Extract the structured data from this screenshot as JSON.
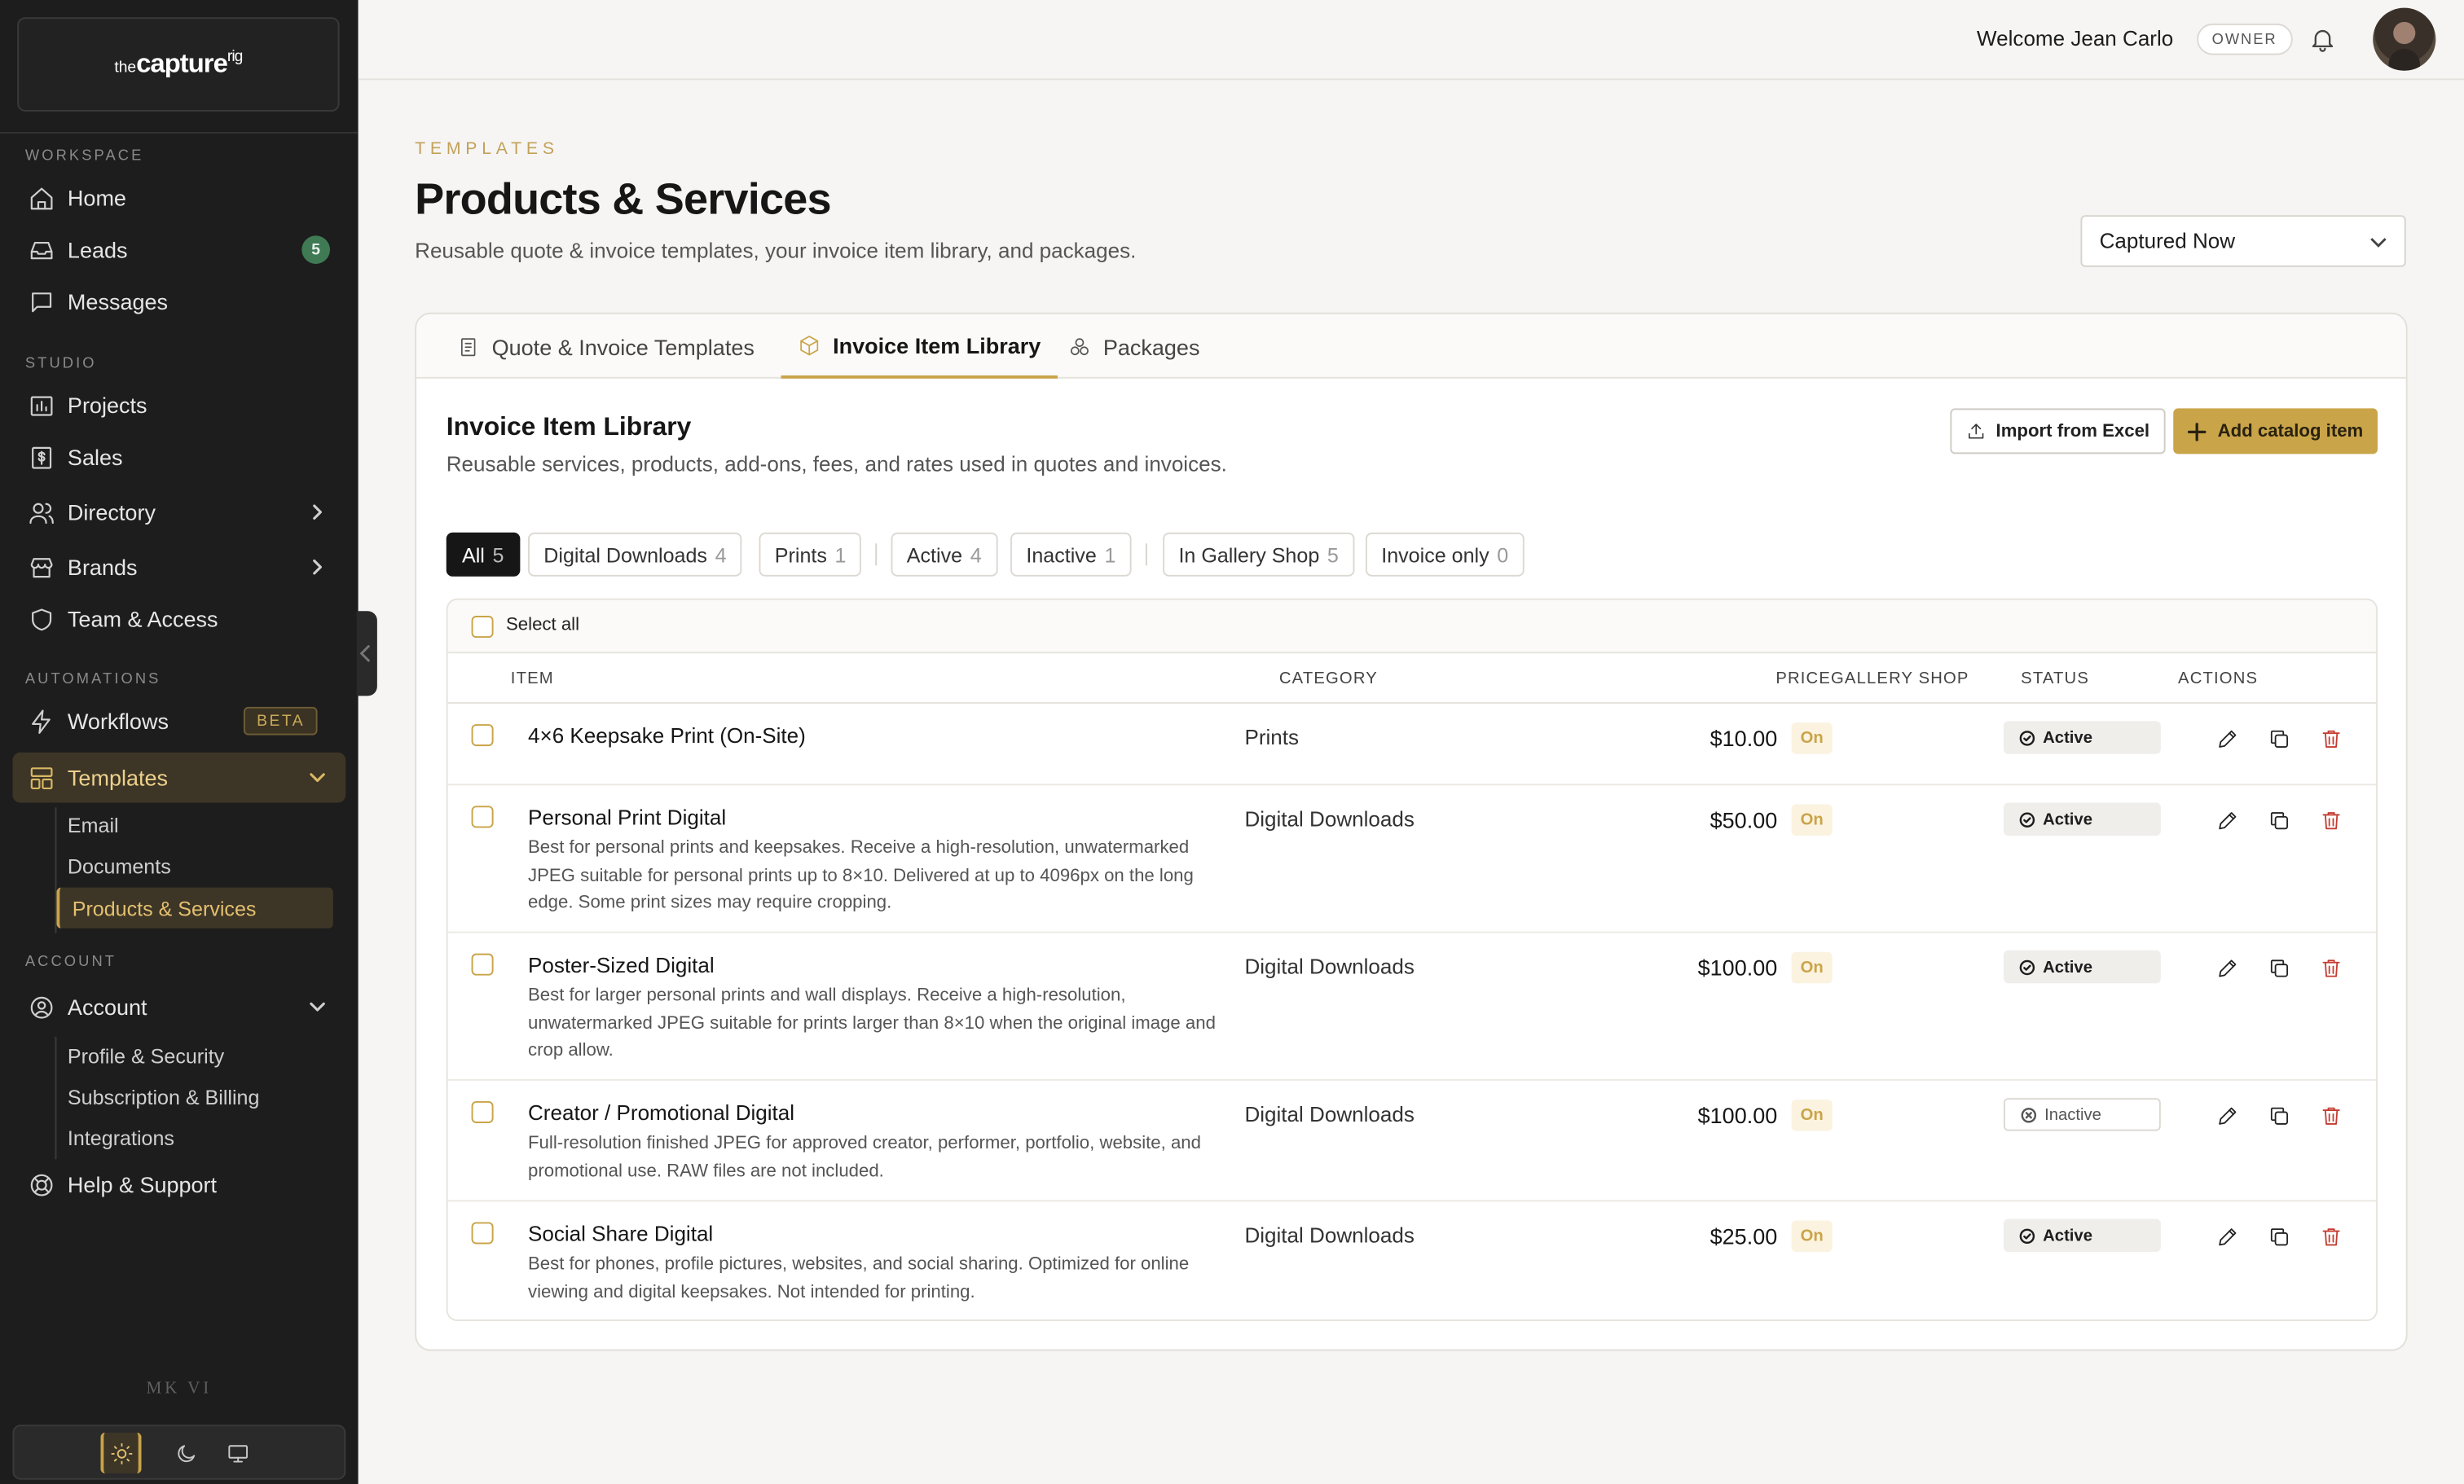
{
  "brand": {
    "logo_prefix": "the",
    "logo_main": "capture",
    "logo_sup": "rig"
  },
  "sidebar": {
    "sections": {
      "workspace": "WORKSPACE",
      "studio": "STUDIO",
      "automations": "AUTOMATIONS",
      "account": "ACCOUNT"
    },
    "items": {
      "home": "Home",
      "leads": "Leads",
      "leads_badge": "5",
      "messages": "Messages",
      "projects": "Projects",
      "sales": "Sales",
      "directory": "Directory",
      "brands": "Brands",
      "team": "Team & Access",
      "workflows": "Workflows",
      "workflows_badge": "BETA",
      "templates": "Templates",
      "account": "Account",
      "help": "Help & Support"
    },
    "templates_sub": [
      "Email",
      "Documents",
      "Products & Services"
    ],
    "account_sub": [
      "Profile & Security",
      "Subscription & Billing",
      "Integrations"
    ],
    "footer_mark": "MK VI"
  },
  "topbar": {
    "welcome": "Welcome Jean Carlo",
    "role": "OWNER"
  },
  "header": {
    "eyebrow": "TEMPLATES",
    "title": "Products & Services",
    "subtitle": "Reusable quote & invoice templates, your invoice item library, and packages.",
    "brand_select": "Captured Now"
  },
  "tabs": [
    {
      "label": "Quote & Invoice Templates",
      "active": false
    },
    {
      "label": "Invoice Item Library",
      "active": true
    },
    {
      "label": "Packages",
      "active": false
    }
  ],
  "library": {
    "title": "Invoice Item Library",
    "description": "Reusable services, products, add-ons, fees, and rates used in quotes and invoices.",
    "import_label": "Import from Excel",
    "add_label": "Add catalog item"
  },
  "filters": [
    {
      "label": "All",
      "count": "5"
    },
    {
      "label": "Digital Downloads",
      "count": "4"
    },
    {
      "label": "Prints",
      "count": "1"
    },
    {
      "label": "Active",
      "count": "4"
    },
    {
      "label": "Inactive",
      "count": "1"
    },
    {
      "label": "In Gallery Shop",
      "count": "5"
    },
    {
      "label": "Invoice only",
      "count": "0"
    }
  ],
  "table": {
    "select_all": "Select all",
    "columns": {
      "item": "ITEM",
      "category": "CATEGORY",
      "price_gallery": "PRICEGALLERY SHOP",
      "status": "STATUS",
      "actions": "ACTIONS"
    },
    "rows": [
      {
        "name": "4×6 Keepsake Print (On-Site)",
        "desc": "",
        "category": "Prints",
        "price": "$10.00",
        "gallery": "On",
        "status": "Active"
      },
      {
        "name": "Personal Print Digital",
        "desc": "Best for personal prints and keepsakes. Receive a high-resolution, unwatermarked JPEG suitable for personal prints up to 8×10. Delivered at up to 4096px on the long edge. Some print sizes may require cropping.",
        "category": "Digital Downloads",
        "price": "$50.00",
        "gallery": "On",
        "status": "Active"
      },
      {
        "name": "Poster-Sized Digital",
        "desc": "Best for larger personal prints and wall displays. Receive a high-resolution, unwatermarked JPEG suitable for prints larger than 8×10 when the original image and crop allow.",
        "category": "Digital Downloads",
        "price": "$100.00",
        "gallery": "On",
        "status": "Active"
      },
      {
        "name": "Creator / Promotional Digital",
        "desc": "Full-resolution finished JPEG for approved creator, performer, portfolio, website, and promotional use. RAW files are not included.",
        "category": "Digital Downloads",
        "price": "$100.00",
        "gallery": "On",
        "status": "Inactive"
      },
      {
        "name": "Social Share Digital",
        "desc": "Best for phones, profile pictures, websites, and social sharing. Optimized for online viewing and digital keepsakes. Not intended for printing.",
        "category": "Digital Downloads",
        "price": "$25.00",
        "gallery": "On",
        "status": "Active"
      }
    ]
  },
  "colors": {
    "accent": "#c9a449",
    "sidebar_bg": "#1d1d1d",
    "danger": "#c43b30"
  }
}
